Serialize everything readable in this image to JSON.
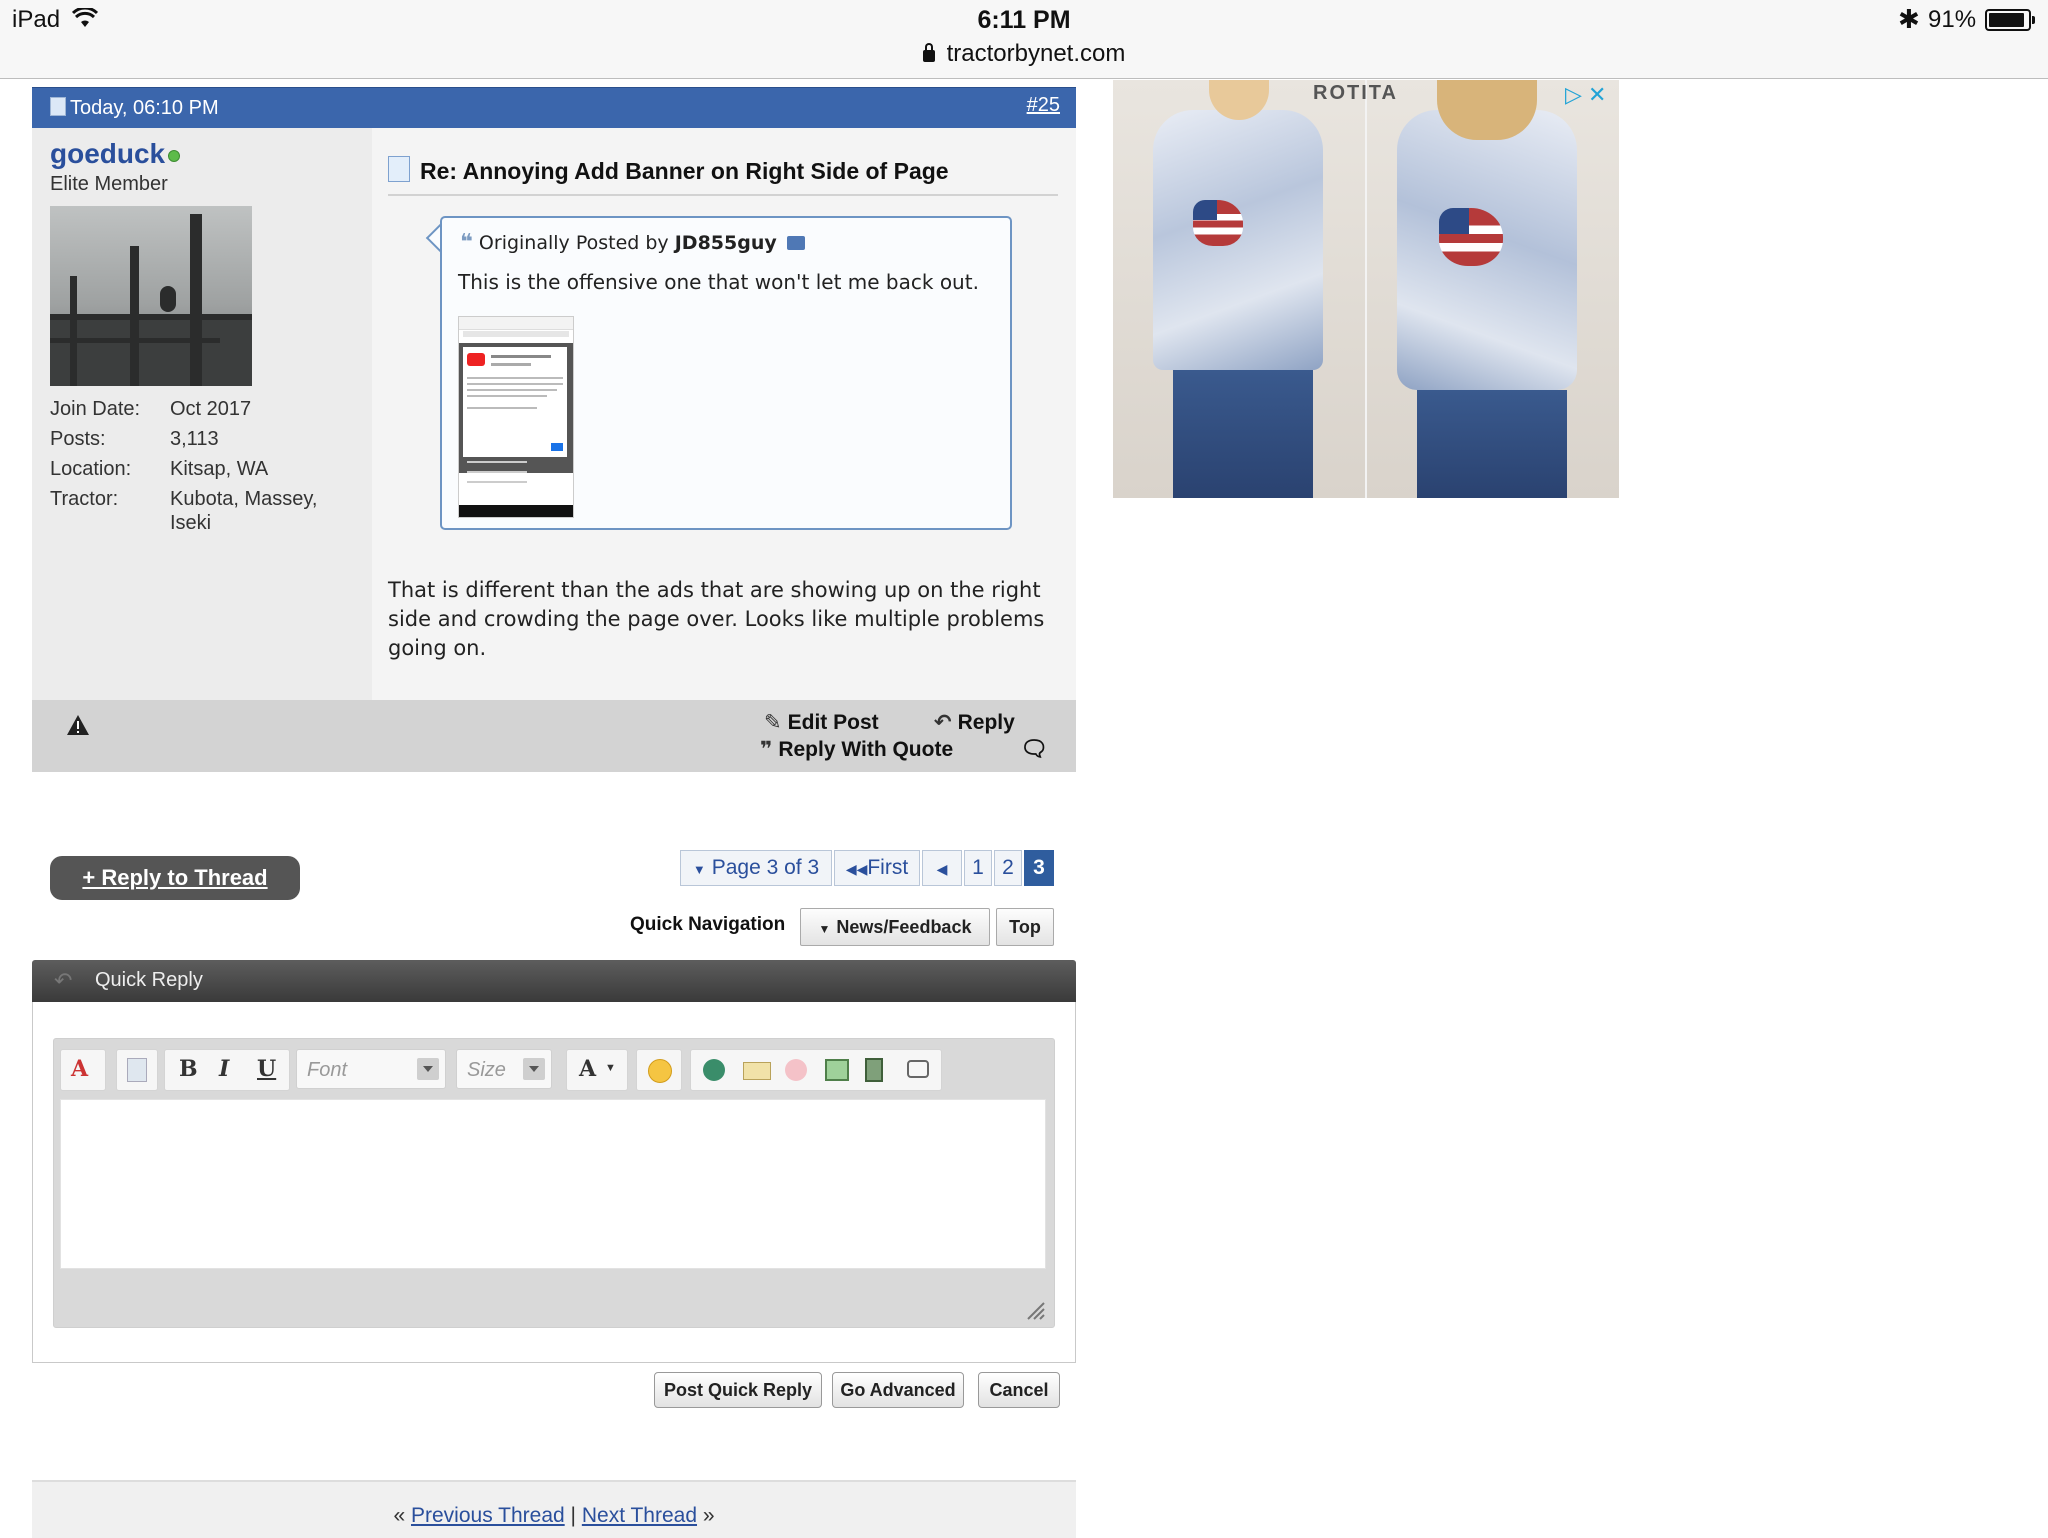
{
  "status_bar": {
    "device": "iPad",
    "time": "6:11 PM",
    "url": "tractorbynet.com",
    "battery": "91%",
    "battery_level": 0.91
  },
  "post": {
    "date": "Today, 06:10 PM",
    "number": "#25",
    "username": "goeduck",
    "user_title": "Elite Member",
    "user_info": [
      {
        "label": "Join Date:",
        "value": "Oct 2017"
      },
      {
        "label": "Posts:",
        "value": "3,113"
      },
      {
        "label": "Location:",
        "value": "Kitsap, WA"
      },
      {
        "label": "Tractor:",
        "value": "Kubota, Massey,",
        "value2": "Iseki"
      }
    ],
    "title": "Re: Annoying Add Banner on Right Side of Page",
    "quote": {
      "prefix": "Originally Posted by",
      "author": "JD855guy",
      "text": "This is the offensive one that won't let me back out."
    },
    "message": "That is different than the ads that are showing up on the right side and crowding the page over. Looks like multiple problems going on.",
    "footer": {
      "edit": "Edit Post",
      "reply": "Reply",
      "reply_quote": "Reply With Quote"
    }
  },
  "thread_nav": {
    "reply_to_thread": "+ Reply to Thread",
    "page_label": "Page 3 of 3",
    "first": "First",
    "pages": [
      "1",
      "2",
      "3"
    ],
    "current_page": "3",
    "quick_navigation": "Quick Navigation",
    "forum": "News/Feedback",
    "top": "Top"
  },
  "quick_reply": {
    "title": "Quick Reply",
    "toolbar": {
      "bold": "B",
      "italic": "I",
      "underline": "U",
      "font_placeholder": "Font",
      "size_placeholder": "Size",
      "color": "A"
    },
    "buttons": {
      "post": "Post Quick Reply",
      "advanced": "Go Advanced",
      "cancel": "Cancel"
    }
  },
  "footer_nav": {
    "prev": "Previous Thread",
    "next": "Next Thread",
    "sep": "|",
    "left_quote": "«",
    "right_quote": "»"
  },
  "ad": {
    "brand": "ROTITA"
  },
  "colors": {
    "header_blue": "#3b66ac",
    "link_blue": "#2a4f9c",
    "quick_reply_dark": "#3a3a3a"
  }
}
